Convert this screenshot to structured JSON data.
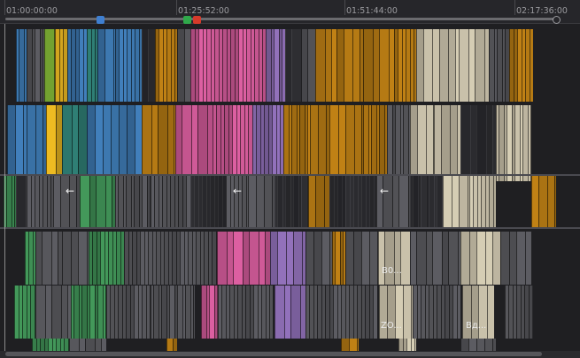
{
  "timeline": {
    "timecodes": [
      "01:00:00:00",
      "01:25:52:00",
      "01:51:44:00",
      "02:17:36:00"
    ],
    "markers": [
      {
        "name": "blue-marker",
        "color": "#3f7fd0"
      },
      {
        "name": "green-marker",
        "color": "#2fa84a"
      },
      {
        "name": "red-marker",
        "color": "#d63a2a"
      }
    ]
  },
  "clip_labels": {
    "b0": "B0...",
    "zo": "ZO...",
    "vd": "Вд..."
  },
  "colors": {
    "blue": "#3d78b0",
    "lime": "#8cc43a",
    "yellow": "#e0b020",
    "teal": "#2f7f75",
    "pink": "#d05a98",
    "purple": "#8a6bb0",
    "orange": "#b57a14",
    "beige": "#c9c1aa",
    "grey": "#57575c",
    "green": "#3f8f55",
    "empty": "#2b2b2f"
  }
}
